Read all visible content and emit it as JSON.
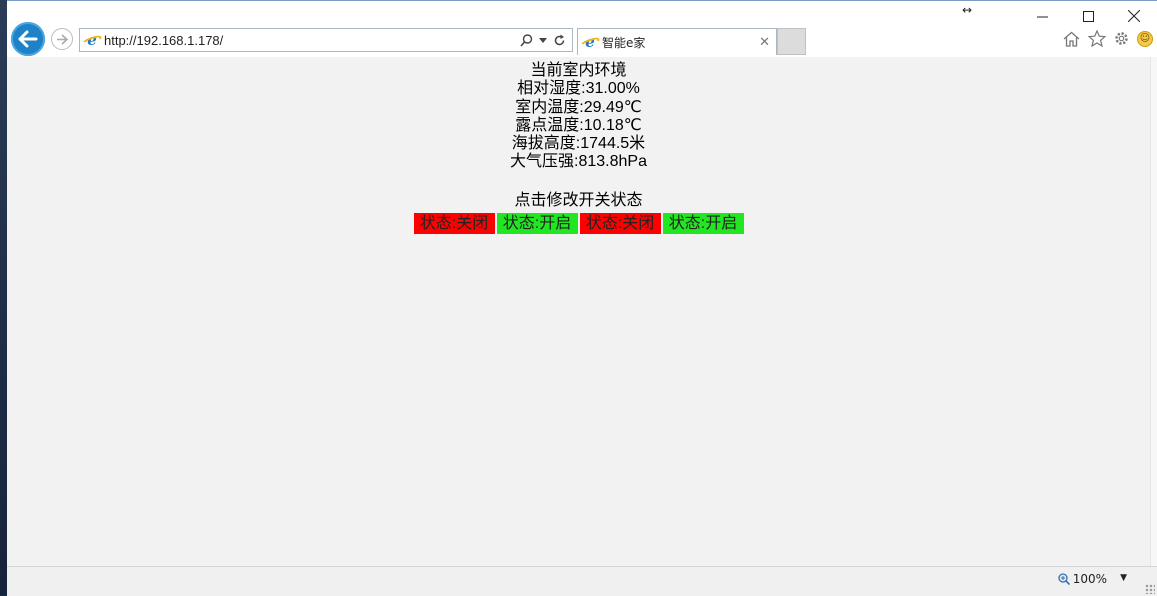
{
  "browser": {
    "url": "http://192.168.1.178/",
    "tab_title": "智能e家",
    "zoom_level": "100%"
  },
  "environment": {
    "title": "当前室内环境",
    "humidity": "相对湿度:31.00%",
    "temperature": "室内温度:29.49℃",
    "dew_point": "露点温度:10.18℃",
    "altitude": "海拔高度:1744.5米",
    "pressure": "大气压强:813.8hPa"
  },
  "switches": {
    "title": "点击修改开关状态",
    "items": [
      {
        "label": "状态:关闭",
        "color": "#ff0000"
      },
      {
        "label": "状态:开启",
        "color": "#22e622"
      },
      {
        "label": "状态:关闭",
        "color": "#ff0000"
      },
      {
        "label": "状态:开启",
        "color": "#22e622"
      }
    ]
  },
  "colors": {
    "off": "#ff0000",
    "on": "#22e622",
    "page_background": "#f2f2f2",
    "back_button": "#1d82c7"
  }
}
